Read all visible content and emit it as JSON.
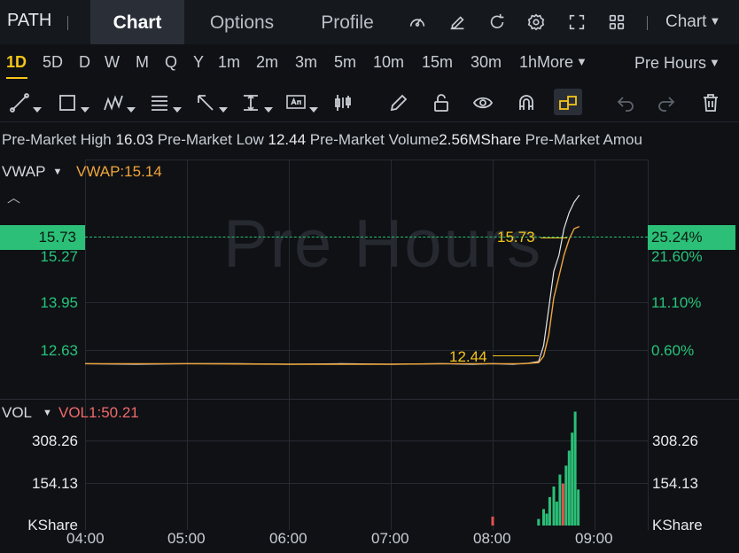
{
  "header": {
    "ticker": "PATH",
    "tabs": [
      {
        "label": "Chart",
        "active": true
      },
      {
        "label": "Options",
        "active": false
      },
      {
        "label": "Profile",
        "active": false
      }
    ],
    "icons": [
      "gauge-icon",
      "edit-icon",
      "refresh-icon",
      "gear-icon",
      "expand-icon",
      "grid-icon"
    ],
    "chart_menu_label": "Chart"
  },
  "periods": {
    "items": [
      "1D",
      "5D",
      "D",
      "W",
      "M",
      "Q",
      "Y",
      "1m",
      "2m",
      "3m",
      "5m",
      "10m",
      "15m",
      "30m",
      "1h"
    ],
    "active": "1D",
    "more_label": "More",
    "session_label": "Pre Hours"
  },
  "drawing_tools": [
    "line-tool-icon",
    "rectangle-tool-icon",
    "pattern-tool-icon",
    "fib-tool-icon",
    "arrow-tool-icon",
    "measure-tool-icon",
    "text-tool-icon",
    "candle-tool-icon",
    "pen-icon",
    "unlock-icon",
    "eye-icon",
    "magnet-icon",
    "link-icon",
    "undo-icon",
    "redo-icon",
    "trash-icon"
  ],
  "stats": [
    {
      "label": "Pre-Market High",
      "value": "16.03"
    },
    {
      "label": "Pre-Market Low",
      "value": "12.44"
    },
    {
      "label": "Pre-Market Volume",
      "value": "2.56MShare"
    },
    {
      "label": "Pre-Market Amou",
      "value": ""
    }
  ],
  "watermark": "Pre Hours",
  "colors": {
    "up": "#2bbf77",
    "accent": "#f5c518",
    "vwap": "#f0a53a",
    "vol_label": "#f06a6a",
    "down": "#e0524f"
  },
  "chart_data": [
    {
      "type": "line",
      "indicator_name": "VWAP",
      "indicator_value": "VWAP:15.14",
      "x_ticks": [
        "04:00",
        "05:00",
        "06:00",
        "07:00",
        "08:00",
        "09:00"
      ],
      "left_axis": [
        "15.73",
        "15.27",
        "13.95",
        "12.63"
      ],
      "right_axis": [
        "25.24%",
        "21.60%",
        "11.10%",
        "0.60%"
      ],
      "current_price": "15.73",
      "current_change": "25.24%",
      "high_mark": "15.73",
      "low_mark": "12.44",
      "ylim": [
        11.9,
        16.4
      ],
      "series": [
        {
          "name": "",
          "points": [
            [
              0,
              12.56
            ],
            [
              0.5,
              12.55
            ],
            [
              1,
              12.56
            ],
            [
              1.5,
              12.56
            ],
            [
              2,
              12.55
            ],
            [
              2.5,
              12.56
            ],
            [
              3,
              12.55
            ],
            [
              3.5,
              12.56
            ],
            [
              3.8,
              12.55
            ],
            [
              4,
              12.56
            ],
            [
              4.2,
              12.55
            ],
            [
              4.35,
              12.57
            ],
            [
              4.45,
              12.6
            ],
            [
              4.5,
              12.9
            ],
            [
              4.55,
              13.6
            ],
            [
              4.6,
              14.3
            ],
            [
              4.65,
              14.6
            ],
            [
              4.7,
              15.1
            ],
            [
              4.75,
              15.4
            ],
            [
              4.8,
              15.6
            ],
            [
              4.85,
              15.73
            ]
          ]
        },
        {
          "name": "",
          "points": [
            [
              0,
              12.56
            ],
            [
              1,
              12.56
            ],
            [
              2,
              12.55
            ],
            [
              3,
              12.55
            ],
            [
              3.5,
              12.56
            ],
            [
              4,
              12.56
            ],
            [
              4.3,
              12.56
            ],
            [
              4.45,
              12.58
            ],
            [
              4.5,
              12.7
            ],
            [
              4.55,
              13.1
            ],
            [
              4.6,
              13.8
            ],
            [
              4.65,
              14.2
            ],
            [
              4.7,
              14.6
            ],
            [
              4.75,
              14.9
            ],
            [
              4.8,
              15.1
            ],
            [
              4.85,
              15.14
            ]
          ]
        }
      ]
    },
    {
      "type": "bar",
      "indicator_name": "VOL",
      "indicator_value": "VOL1:50.21",
      "y_ticks": [
        "308.26",
        "154.13",
        "KShare"
      ],
      "ylim": [
        0,
        420
      ],
      "bars": [
        {
          "x": 4.0,
          "value": 30,
          "up": false
        },
        {
          "x": 4.45,
          "value": 22,
          "up": true
        },
        {
          "x": 4.5,
          "value": 55,
          "up": true
        },
        {
          "x": 4.53,
          "value": 40,
          "up": true
        },
        {
          "x": 4.56,
          "value": 95,
          "up": true
        },
        {
          "x": 4.6,
          "value": 130,
          "up": true
        },
        {
          "x": 4.63,
          "value": 80,
          "up": true
        },
        {
          "x": 4.66,
          "value": 170,
          "up": true
        },
        {
          "x": 4.69,
          "value": 140,
          "up": false
        },
        {
          "x": 4.72,
          "value": 200,
          "up": true
        },
        {
          "x": 4.75,
          "value": 250,
          "up": true
        },
        {
          "x": 4.78,
          "value": 310,
          "up": true
        },
        {
          "x": 4.81,
          "value": 380,
          "up": true
        },
        {
          "x": 4.84,
          "value": 120,
          "up": true
        }
      ]
    }
  ]
}
